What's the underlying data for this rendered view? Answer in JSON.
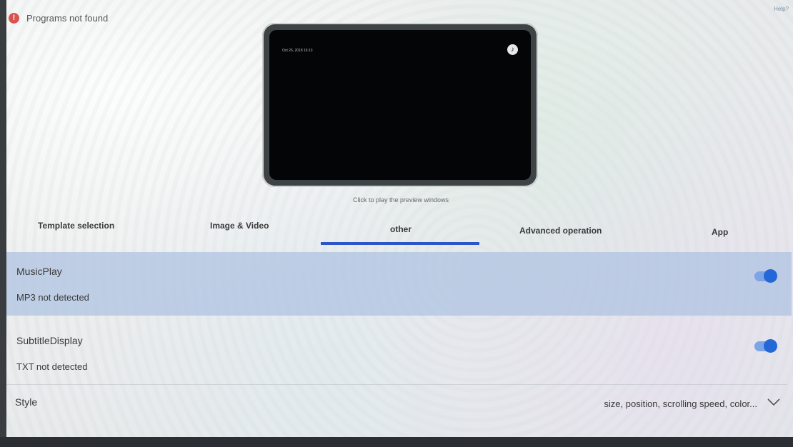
{
  "status": {
    "message": "Programs not found",
    "icon": "warning-icon"
  },
  "help": {
    "label": "Help?"
  },
  "preview": {
    "timestamp": "Oct 26, 2018 16:13",
    "caption": "Click to play the preview windows",
    "music_icon": "music-note-icon"
  },
  "tabs": [
    {
      "label": "Template selection"
    },
    {
      "label": "Image & Video"
    },
    {
      "label": "other",
      "active": true
    },
    {
      "label": "Advanced operation"
    },
    {
      "label": "App"
    }
  ],
  "settings": {
    "music": {
      "title": "MusicPlay",
      "status": "MP3 not detected",
      "enabled": true
    },
    "subtitle": {
      "title": "SubtitleDisplay",
      "status": "TXT not detected",
      "enabled": true
    },
    "style": {
      "title": "Style",
      "description": "size, position, scrolling speed, color..."
    }
  },
  "colors": {
    "accent": "#2468d8",
    "tab_underline": "#2d55c8",
    "selected_row": "#afc3e1",
    "warning": "#d9534f"
  }
}
